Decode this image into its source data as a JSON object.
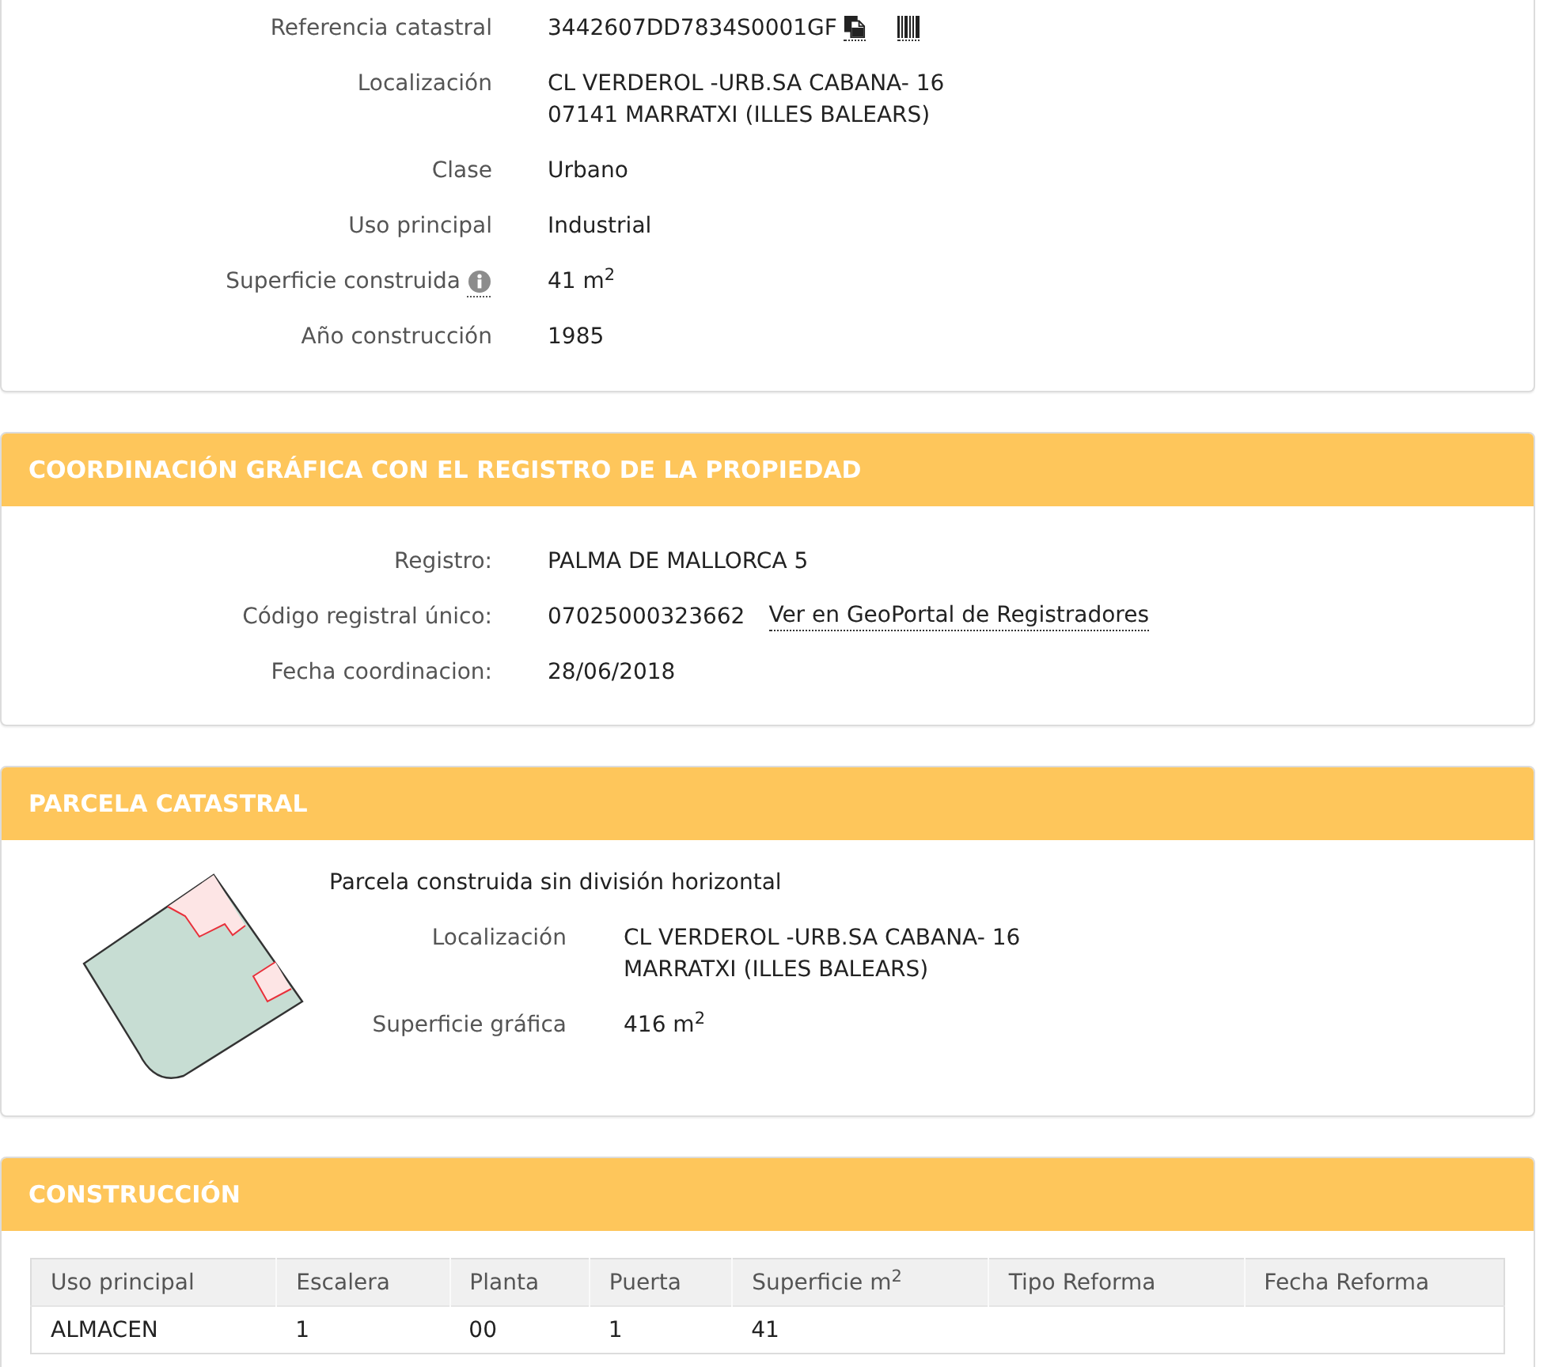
{
  "building": {
    "rows": [
      {
        "kind": "reference",
        "label": "Referencia catastral",
        "value": "3442607DD7834S0001GF"
      },
      {
        "kind": "lines",
        "label": "Localización",
        "lines": [
          "CL VERDEROL -URB.SA CABANA- 16",
          "07141 MARRATXI (ILLES BALEARS)"
        ]
      },
      {
        "kind": "text",
        "label": "Clase",
        "value": "Urbano"
      },
      {
        "kind": "text",
        "label": "Uso principal",
        "value": "Industrial"
      },
      {
        "kind": "info",
        "label": "Superficie construida",
        "value": "41 m$^{2}$"
      },
      {
        "kind": "text",
        "label": "Año construcción",
        "value": "1985"
      }
    ]
  },
  "registry": {
    "title": "COORDINACIÓN GRÁFICA CON EL REGISTRO DE LA PROPIEDAD",
    "rows": [
      {
        "kind": "text",
        "label": "Registro:",
        "value": "PALMA DE MALLORCA 5"
      },
      {
        "kind": "link",
        "label": "Código registral único:",
        "value": "07025000323662",
        "link": "Ver en GeoPortal de Registradores"
      },
      {
        "kind": "text",
        "label": "Fecha coordinacion:",
        "value": "28/06/2018"
      }
    ]
  },
  "parcel": {
    "title": "PARCELA CATASTRAL",
    "description": "Parcela construida sin división horizontal",
    "rows": [
      {
        "kind": "lines",
        "label": "Localización",
        "lines": [
          "CL VERDEROL -URB.SA CABANA- 16",
          "MARRATXI (ILLES BALEARS)"
        ]
      },
      {
        "kind": "text",
        "label": "Superficie gráfica",
        "value": "416 m$^{2}$"
      }
    ]
  },
  "construction": {
    "title": "CONSTRUCCIÓN",
    "table": {
      "columns": [
        "Uso principal",
        "Escalera",
        "Planta",
        "Puerta",
        "Superficie m$^{2}$",
        "Tipo Reforma",
        "Fecha Reforma"
      ],
      "rows": [
        {
          "cells": [
            "ALMACEN",
            "1",
            "00",
            "1",
            "41"
          ]
        }
      ]
    }
  }
}
